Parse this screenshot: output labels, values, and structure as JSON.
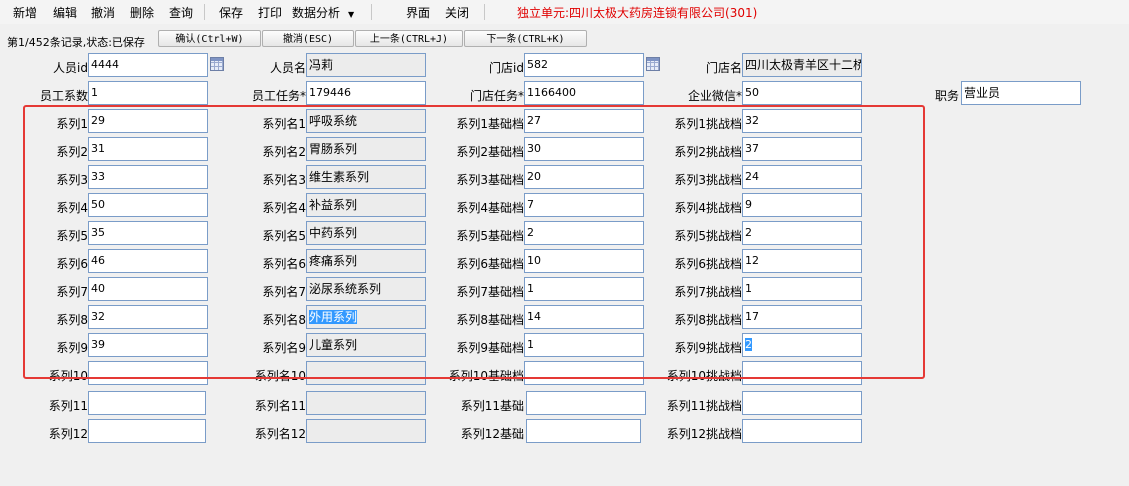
{
  "menu": {
    "new": "新增",
    "edit": "编辑",
    "undo": "撤消",
    "delete": "删除",
    "query": "查询",
    "save": "保存",
    "print": "打印",
    "analysis": "数据分析",
    "interface": "界面",
    "close": "关闭"
  },
  "unit": "独立单元:四川太极大药房连锁有限公司(301)",
  "status": {
    "text": "第1/452条记录,状态:已保存",
    "confirm": "确认(Ctrl+W)",
    "cancel": "撤消(ESC)",
    "prev": "上一条(CTRL+J)",
    "next": "下一条(CTRL+K)"
  },
  "header": {
    "staff_id_label": "人员id",
    "staff_id": "4444",
    "staff_name_label": "人员名",
    "staff_name": "冯莉",
    "store_id_label": "门店id",
    "store_id": "582",
    "store_name_label": "门店名",
    "store_name": "四川太极青羊区十二桥",
    "coef_label": "员工系数",
    "coef": "1",
    "task_label": "员工任务*",
    "task": "179446",
    "store_task_label": "门店任务*",
    "store_task": "1166400",
    "wechat_label": "企业微信*",
    "wechat": "50",
    "position_label": "职务",
    "position": "营业员"
  },
  "rows": [
    {
      "series_label": "系列1",
      "series": "29",
      "name_label": "系列名1",
      "name": "呼吸系统",
      "base_label": "系列1基础档",
      "base": "27",
      "chal_label": "系列1挑战档",
      "chal": "32"
    },
    {
      "series_label": "系列2",
      "series": "31",
      "name_label": "系列名2",
      "name": "胃肠系列",
      "base_label": "系列2基础档",
      "base": "30",
      "chal_label": "系列2挑战档",
      "chal": "37"
    },
    {
      "series_label": "系列3",
      "series": "33",
      "name_label": "系列名3",
      "name": "维生素系列",
      "base_label": "系列3基础档",
      "base": "20",
      "chal_label": "系列3挑战档",
      "chal": "24"
    },
    {
      "series_label": "系列4",
      "series": "50",
      "name_label": "系列名4",
      "name": "补益系列",
      "base_label": "系列4基础档",
      "base": "7",
      "chal_label": "系列4挑战档",
      "chal": "9"
    },
    {
      "series_label": "系列5",
      "series": "35",
      "name_label": "系列名5",
      "name": "中药系列",
      "base_label": "系列5基础档",
      "base": "2",
      "chal_label": "系列5挑战档",
      "chal": "2"
    },
    {
      "series_label": "系列6",
      "series": "46",
      "name_label": "系列名6",
      "name": "疼痛系列",
      "base_label": "系列6基础档",
      "base": "10",
      "chal_label": "系列6挑战档",
      "chal": "12"
    },
    {
      "series_label": "系列7",
      "series": "40",
      "name_label": "系列名7",
      "name": "泌尿系统系列",
      "base_label": "系列7基础档",
      "base": "1",
      "chal_label": "系列7挑战档",
      "chal": "1"
    },
    {
      "series_label": "系列8",
      "series": "32",
      "name_label": "系列名8",
      "name": "外用系列",
      "base_label": "系列8基础档",
      "base": "14",
      "chal_label": "系列8挑战档",
      "chal": "17"
    },
    {
      "series_label": "系列9",
      "series": "39",
      "name_label": "系列名9",
      "name": "儿童系列",
      "base_label": "系列9基础档",
      "base": "1",
      "chal_label": "系列9挑战档",
      "chal": "2"
    },
    {
      "series_label": "系列10",
      "series": "",
      "name_label": "系列名10",
      "name": "",
      "base_label": "系列10基础档",
      "base": "",
      "chal_label": "系列10挑战档",
      "chal": ""
    },
    {
      "series_label": "系列11",
      "series": "",
      "name_label": "系列名11",
      "name": "",
      "base_label": "系列11基础",
      "base": "",
      "chal_label": "系列11挑战档",
      "chal": ""
    },
    {
      "series_label": "系列12",
      "series": "",
      "name_label": "系列名12",
      "name": "",
      "base_label": "系列12基础",
      "base": "",
      "chal_label": "系列12挑战档",
      "chal": ""
    }
  ]
}
